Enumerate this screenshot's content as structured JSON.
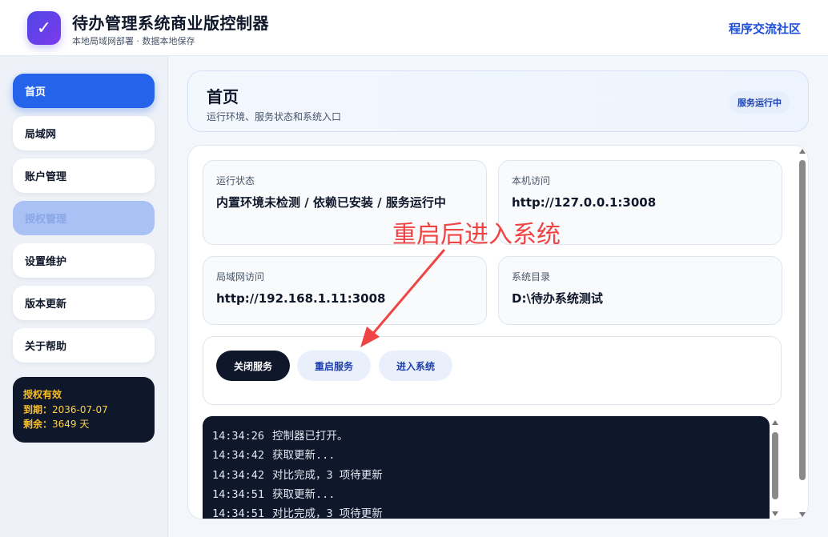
{
  "header": {
    "logo_glyph": "✓",
    "title": "待办管理系统商业版控制器",
    "subtitle": "本地局域网部署 · 数据本地保存",
    "community_link": "程序交流社区"
  },
  "sidebar": {
    "items": [
      {
        "label": "首页",
        "state": "active"
      },
      {
        "label": "局域网",
        "state": "normal"
      },
      {
        "label": "账户管理",
        "state": "normal"
      },
      {
        "label": "授权管理",
        "state": "disabled"
      },
      {
        "label": "设置维护",
        "state": "normal"
      },
      {
        "label": "版本更新",
        "state": "normal"
      },
      {
        "label": "关于帮助",
        "state": "normal"
      }
    ],
    "license": {
      "title": "授权有效",
      "expiry_label": "到期：",
      "expiry_value": "2036-07-07",
      "remaining_label": "剩余：",
      "remaining_value": "3649 天"
    }
  },
  "page": {
    "title": "首页",
    "description": "运行环境、服务状态和系统入口",
    "status_badge": "服务运行中"
  },
  "info_cards": [
    {
      "label": "运行状态",
      "value": "内置环境未检测 / 依赖已安装 / 服务运行中"
    },
    {
      "label": "本机访问",
      "value": "http://127.0.0.1:3008"
    },
    {
      "label": "局域网访问",
      "value": "http://192.168.1.11:3008"
    },
    {
      "label": "系统目录",
      "value": "D:\\待办系统测试"
    }
  ],
  "actions": {
    "stop": "关闭服务",
    "restart": "重启服务",
    "enter": "进入系统"
  },
  "log": [
    {
      "time": "14:34:26",
      "msg": "控制器已打开。"
    },
    {
      "time": "14:34:42",
      "msg": "获取更新..."
    },
    {
      "time": "14:34:42",
      "msg": "对比完成，3 项待更新"
    },
    {
      "time": "14:34:51",
      "msg": "获取更新..."
    },
    {
      "time": "14:34:51",
      "msg": "对比完成，3 项待更新"
    }
  ],
  "annotation": {
    "text": "重启后进入系统",
    "color": "#ef4444"
  },
  "colors": {
    "accent": "#2563eb",
    "dark": "#0f172a",
    "license_text": "#fbbf24"
  }
}
